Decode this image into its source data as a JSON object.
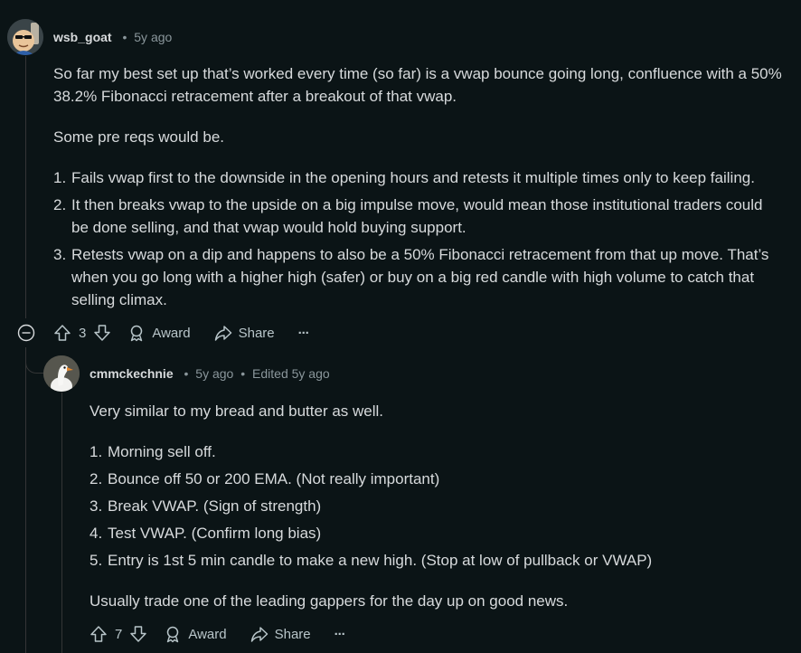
{
  "comments": [
    {
      "username": "wsb_goat",
      "separator": "•",
      "age": "5y ago",
      "intro_lines": [
        "So far my best set up that’s worked every time (so far) is a vwap bounce going long, confluence with a 50%",
        "38.2% Fibonacci retracement after a breakout of that vwap."
      ],
      "prereq_intro": "Some pre reqs would be.",
      "list": [
        {
          "num": "1.",
          "lines": [
            "Fails vwap first to the downside in the opening hours and retests it multiple times only to keep failing."
          ]
        },
        {
          "num": "2.",
          "lines": [
            "It then breaks vwap to the upside on a big impulse move, would mean those institutional traders could",
            "be done selling, and that vwap would hold buying support."
          ]
        },
        {
          "num": "3.",
          "lines": [
            "Retests vwap on a dip and happens to also be a 50% Fibonacci retracement from that up move. That’s",
            "when you go long with a higher high (safer) or buy on a big red candle with high volume to catch that",
            "selling climax."
          ]
        }
      ],
      "actions": {
        "score": "3",
        "award": "Award",
        "share": "Share",
        "more": "···"
      }
    },
    {
      "username": "cmmckechnie",
      "separator": "•",
      "age": "5y ago",
      "separator2": "•",
      "edited": "Edited 5y ago",
      "intro": "Very similar to my bread and butter as well.",
      "list": [
        {
          "num": "1.",
          "text": "Morning sell off."
        },
        {
          "num": "2.",
          "text": "Bounce off 50 or 200 EMA. (Not really important)"
        },
        {
          "num": "3.",
          "text": "Break VWAP. (Sign of strength)"
        },
        {
          "num": "4.",
          "text": "Test VWAP. (Confirm long bias)"
        },
        {
          "num": "5.",
          "text": "Entry is 1st 5 min candle to make a new high. (Stop at low of pullback or VWAP)"
        }
      ],
      "outro": "Usually trade one of the leading gappers for the day up on good news.",
      "actions": {
        "score": "7",
        "award": "Award",
        "share": "Share",
        "more": "···"
      }
    }
  ],
  "icons": {
    "collapse": "collapse-minus-icon",
    "upvote": "upvote-arrow-icon",
    "downvote": "downvote-arrow-icon",
    "award": "award-ribbon-icon",
    "share": "share-arrow-icon",
    "more": "more-dots-icon"
  },
  "colors": {
    "background": "#0b1416",
    "text": "#d7dadc",
    "muted": "#8a969b",
    "thread": "#343536"
  }
}
